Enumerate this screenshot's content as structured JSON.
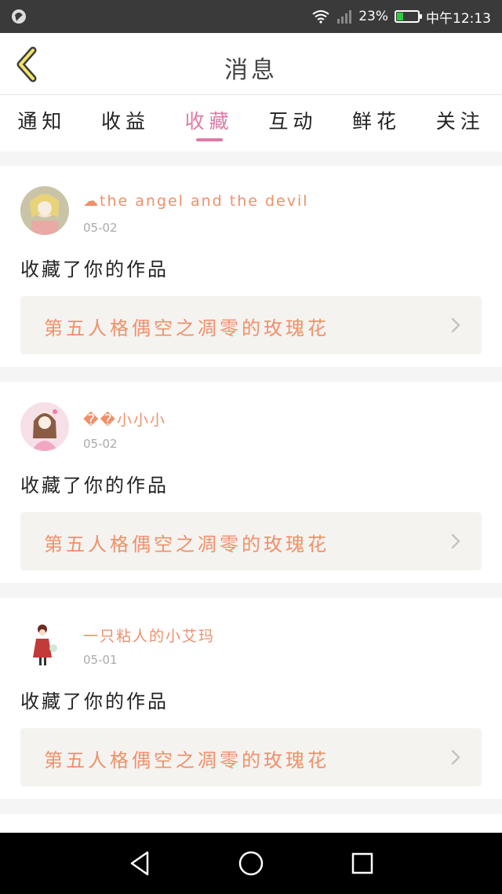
{
  "status_bar": {
    "battery": "23%",
    "time": "中午12:13"
  },
  "header": {
    "title": "消息"
  },
  "tabs": [
    {
      "label": "通知",
      "active": false
    },
    {
      "label": "收益",
      "active": false
    },
    {
      "label": "收藏",
      "active": true
    },
    {
      "label": "互动",
      "active": false
    },
    {
      "label": "鲜花",
      "active": false
    },
    {
      "label": "关注",
      "active": false
    }
  ],
  "messages": [
    {
      "username": "☁the angel and the devil",
      "date": "05-02",
      "action": "收藏了你的作品",
      "work_title": "第五人格偶空之凋零的玫瑰花"
    },
    {
      "username": "��小小小",
      "date": "05-02",
      "action": "收藏了你的作品",
      "work_title": "第五人格偶空之凋零的玫瑰花"
    },
    {
      "username": "一只粘人的小艾玛",
      "date": "05-01",
      "action": "收藏了你的作品",
      "work_title": "第五人格偶空之凋零的玫瑰花"
    }
  ],
  "colors": {
    "accent": "#e07aa6",
    "link_text": "#f0906a",
    "card_link_bg": "#f4f3ef"
  }
}
